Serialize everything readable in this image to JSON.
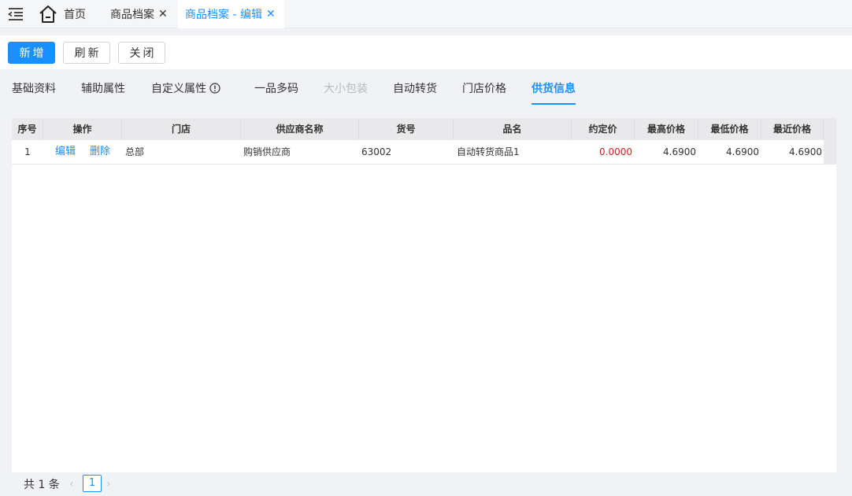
{
  "tabs": {
    "home": "首页",
    "archive": "商品档案",
    "edit": "商品档案 - 编辑",
    "close_glyph": "✕"
  },
  "toolbar": {
    "add": "新增",
    "refresh": "刷新",
    "close": "关闭"
  },
  "subtabs": {
    "basic": "基础资料",
    "aux": "辅助属性",
    "custom": "自定义属性",
    "multicode": "一品多码",
    "pack": "大小包装",
    "autoswitch": "自动转货",
    "storeprice": "门店价格",
    "supply": "供货信息"
  },
  "grid": {
    "headers": {
      "seq": "序号",
      "op": "操作",
      "store": "门店",
      "supplier": "供应商名称",
      "sku": "货号",
      "name": "品名",
      "agreed": "约定价",
      "max": "最高价格",
      "min": "最低价格",
      "recent": "最近价格"
    },
    "rows": [
      {
        "seq": "1",
        "edit": "编辑",
        "delete": "删除",
        "store": "总部",
        "supplier": "购销供应商",
        "sku": "63002",
        "name": "自动转货商品1",
        "agreed": "0.0000",
        "max": "4.6900",
        "min": "4.6900",
        "recent": "4.6900"
      }
    ]
  },
  "pagination": {
    "total": "共 1 条",
    "prev": "‹",
    "page": "1",
    "next": "›"
  },
  "colors": {
    "primary": "#1890ff",
    "negative": "#e02020"
  }
}
